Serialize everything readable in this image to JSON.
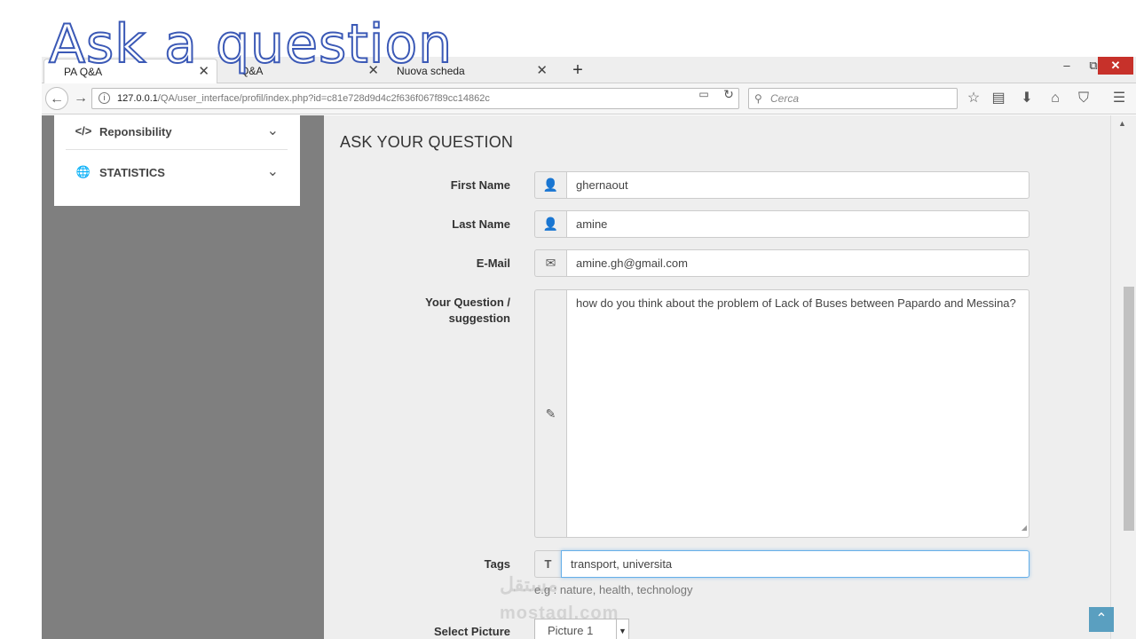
{
  "overlay": {
    "title": "Ask a question"
  },
  "browser": {
    "tabs": [
      {
        "label": "PA Q&A",
        "active": true
      },
      {
        "label": "Q&A",
        "active": false
      },
      {
        "label": "Nuova scheda",
        "active": false
      }
    ],
    "new_tab": "+",
    "window": {
      "minimize": "–",
      "maximize": "⧉",
      "close": "✕"
    },
    "url": {
      "host": "127.0.0.1",
      "path": "/QA/user_interface/profil/index.php?id=c81e728d9d4c2f636f067f89cc14862c"
    },
    "search_placeholder": "Cerca"
  },
  "sidebar": {
    "items": [
      {
        "icon": "</>",
        "label": "Reponsibility"
      },
      {
        "icon": "🌐",
        "label": "STATISTICS"
      }
    ]
  },
  "form": {
    "title": "ASK YOUR QUESTION",
    "first_name": {
      "label": "First Name",
      "value": "ghernaout"
    },
    "last_name": {
      "label": "Last Name",
      "value": "amine"
    },
    "email": {
      "label": "E-Mail",
      "value": "amine.gh@gmail.com"
    },
    "question": {
      "label_line1": "Your Question /",
      "label_line2": "suggestion",
      "value": "how do you think about the problem of Lack of Buses between Papardo and Messina?"
    },
    "tags": {
      "label": "Tags",
      "addon": "T",
      "value": "transport, universita",
      "help": "e.g : nature, health, technology"
    },
    "picture": {
      "label": "Select Picture",
      "value": "Picture 1"
    }
  },
  "watermark": {
    "arabic": "مستقل",
    "latin": "mostaql.com"
  },
  "colors": {
    "title_stroke": "#3b59b6",
    "sidebar_bg": "#7f7f7f",
    "content_bg": "#eeeeee",
    "focus": "#66afe9",
    "close_btn": "#c7312a",
    "back_top": "#5a9fc0"
  }
}
